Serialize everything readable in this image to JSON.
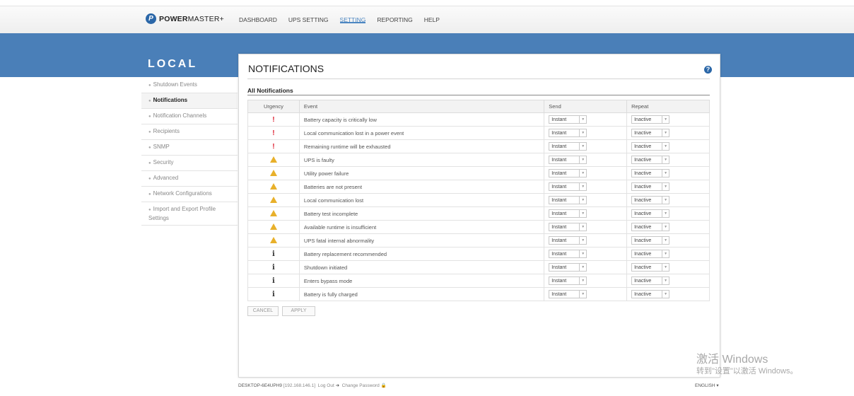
{
  "brand": {
    "name_bold": "POWER",
    "name_rest": "MASTER+",
    "icon_letter": "P"
  },
  "nav": [
    "DASHBOARD",
    "UPS SETTING",
    "SETTING",
    "REPORTING",
    "HELP"
  ],
  "nav_active": "SETTING",
  "sidebar": {
    "title": "LOCAL",
    "items": [
      "Shutdown Events",
      "Notifications",
      "Notification Channels",
      "Recipients",
      "SNMP",
      "Security",
      "Advanced",
      "Network Configurations",
      "Import and Export Profile Settings"
    ],
    "active": "Notifications"
  },
  "panel": {
    "title": "NOTIFICATIONS",
    "help_icon": "question-circle-icon",
    "section_title": "All Notifications",
    "columns": [
      "Urgency",
      "Event",
      "Send",
      "Repeat"
    ],
    "rows": [
      {
        "urgency": "critical",
        "event": "Battery capacity is critically low",
        "send": "Instant",
        "repeat": "Inactive"
      },
      {
        "urgency": "critical",
        "event": "Local communication lost in a power event",
        "send": "Instant",
        "repeat": "Inactive"
      },
      {
        "urgency": "critical",
        "event": "Remaining runtime will be exhausted",
        "send": "Instant",
        "repeat": "Inactive"
      },
      {
        "urgency": "warning",
        "event": "UPS is faulty",
        "send": "Instant",
        "repeat": "Inactive"
      },
      {
        "urgency": "warning",
        "event": "Utility power failure",
        "send": "Instant",
        "repeat": "Inactive"
      },
      {
        "urgency": "warning",
        "event": "Batteries are not present",
        "send": "Instant",
        "repeat": "Inactive"
      },
      {
        "urgency": "warning",
        "event": "Local communication lost",
        "send": "Instant",
        "repeat": "Inactive"
      },
      {
        "urgency": "warning",
        "event": "Battery test incomplete",
        "send": "Instant",
        "repeat": "Inactive"
      },
      {
        "urgency": "warning",
        "event": "Available runtime is insufficient",
        "send": "Instant",
        "repeat": "Inactive"
      },
      {
        "urgency": "warning",
        "event": "UPS fatal internal abnormality",
        "send": "Instant",
        "repeat": "Inactive"
      },
      {
        "urgency": "info",
        "event": "Battery replacement recommended",
        "send": "Instant",
        "repeat": "Inactive"
      },
      {
        "urgency": "info",
        "event": "Shutdown initiated",
        "send": "Instant",
        "repeat": "Inactive"
      },
      {
        "urgency": "info",
        "event": "Enters bypass mode",
        "send": "Instant",
        "repeat": "Inactive"
      },
      {
        "urgency": "info",
        "event": "Battery is fully charged",
        "send": "Instant",
        "repeat": "Inactive"
      }
    ],
    "cancel_label": "CANCEL",
    "apply_label": "APPLY"
  },
  "footer": {
    "host": "DESKTOP-6E4UPH9",
    "ip": "[192.168.146.1]",
    "logout": "Log Out",
    "change_password": "Change Password",
    "language": "ENGLISH"
  },
  "watermark": {
    "line1": "激活 Windows",
    "line2": "转到\"设置\"以激活 Windows。"
  },
  "colors": {
    "banner": "#4a7fb8",
    "accent": "#4d87c2",
    "critical": "#dd2233",
    "warning": "#e8b02a"
  }
}
